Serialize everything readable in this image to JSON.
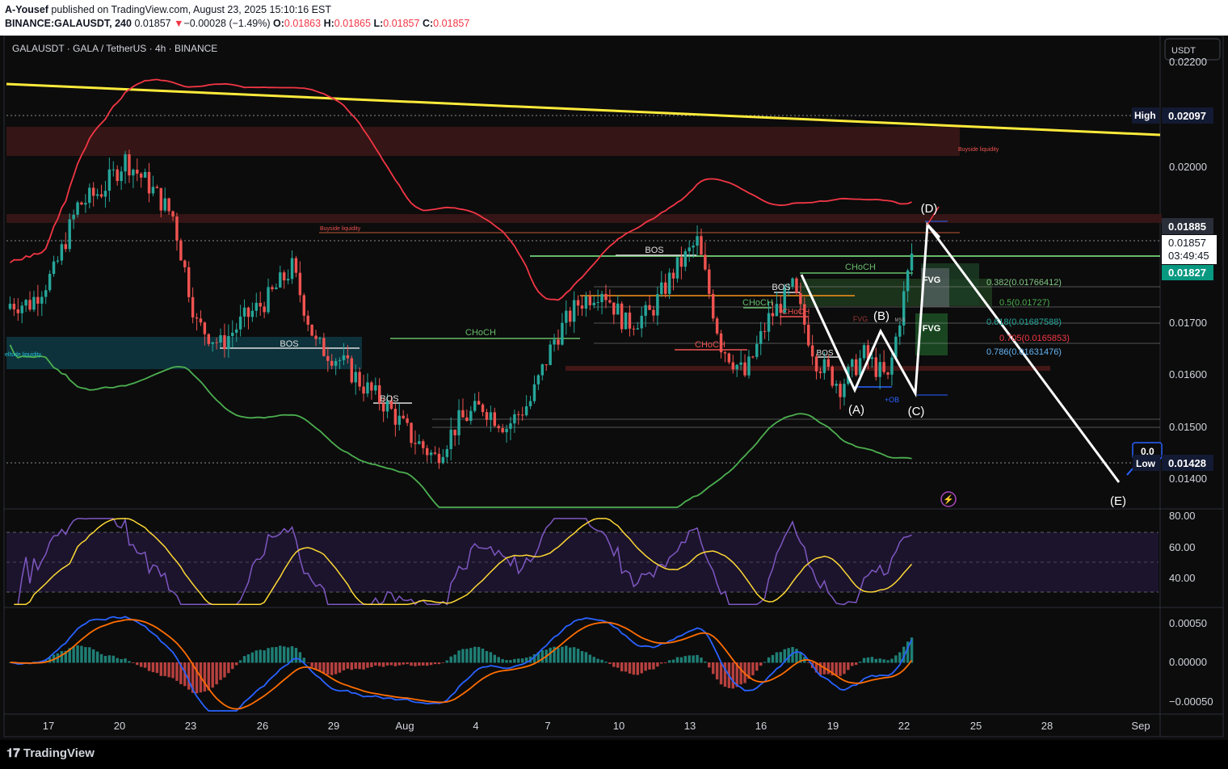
{
  "header": {
    "publisher": "A-Yousef",
    "published_text": "published on TradingView.com, August 23, 2025 15:10:16 EST",
    "symbol_line": "BINANCE:GALAUSDT, 240",
    "last": "0.01857",
    "change_symbol": "▼",
    "change": "−0.00028 (−1.49%)",
    "o_label": "O:",
    "o_val": "0.01863",
    "h_label": "H:",
    "h_val": "0.01865",
    "l_label": "L:",
    "l_val": "0.01857",
    "c_label": "C:",
    "c_val": "0.01857"
  },
  "legend": "GALAUSDT · GALA / TetherUS · 4h · BINANCE",
  "currency_button": "USDT",
  "price_axis": [
    "0.02200",
    "0.02000",
    "0.01885",
    "0.01700",
    "0.01600",
    "0.01500",
    "0.01400"
  ],
  "price_labels": {
    "high_label": "High",
    "high_value": "0.02097",
    "current": "0.01857",
    "countdown": "03:49:45",
    "green_line": "0.01827",
    "low_label": "Low",
    "low_value": "0.01428",
    "alert_partial": "0.0"
  },
  "rsi_axis": [
    "80.00",
    "60.00",
    "40.00"
  ],
  "macd_axis": [
    "0.00050",
    "0.00000",
    "−0.00050"
  ],
  "time_axis": [
    "17",
    "20",
    "23",
    "26",
    "29",
    "Aug",
    "4",
    "7",
    "10",
    "13",
    "16",
    "19",
    "22",
    "25",
    "28",
    "Sep"
  ],
  "annotations": {
    "bos": "BOS",
    "choch": "CHoCH",
    "fvg": "FVG",
    "fvg_faint": "FVG",
    "mss": "MSS",
    "plus_ob": "+OB",
    "buyside_liquidity": "Buyside liquidity",
    "sellside_liquidity": "ellside liquidity",
    "wave_a": "(A)",
    "wave_b": "(B)",
    "wave_c": "(C)",
    "wave_d": "(D)",
    "wave_e": "(E)"
  },
  "fib_levels": [
    {
      "text": "0.382(0.01766412)",
      "color": "#81c784"
    },
    {
      "text": "0.5(0.01727)",
      "color": "#4caf50"
    },
    {
      "text": "0.618(0.01687588)",
      "color": "#089981"
    },
    {
      "text": "0.705(0.0165853)",
      "color": "#f23645"
    },
    {
      "text": "0.786(0.01631476)",
      "color": "#64b5f6"
    }
  ],
  "brand": "TradingView",
  "colors": {
    "up": "#26a69a",
    "down": "#ef5350",
    "bb_upper": "#f23645",
    "bb_lower": "#4caf50",
    "trendline": "#ffeb3b",
    "rsi": "#7e57c2",
    "rsi_ma": "#fdd835",
    "macd": "#2962ff",
    "signal": "#ff6d00"
  },
  "chart_data": {
    "type": "candlestick",
    "symbol": "GALAUSDT",
    "timeframe": "4h",
    "x": [
      "Jul 17",
      "Jul 18",
      "Jul 19",
      "Jul 20",
      "Jul 21",
      "Jul 22",
      "Jul 23",
      "Jul 24",
      "Jul 25",
      "Jul 26",
      "Jul 27",
      "Jul 28",
      "Jul 29",
      "Jul 30",
      "Jul 31",
      "Aug 1",
      "Aug 2",
      "Aug 3",
      "Aug 4",
      "Aug 5",
      "Aug 6",
      "Aug 7",
      "Aug 8",
      "Aug 9",
      "Aug 10",
      "Aug 11",
      "Aug 12",
      "Aug 13",
      "Aug 14",
      "Aug 15",
      "Aug 16",
      "Aug 17",
      "Aug 18",
      "Aug 19",
      "Aug 20",
      "Aug 21",
      "Aug 22",
      "Aug 23"
    ],
    "close_approx": [
      0.0176,
      0.0182,
      0.0195,
      0.0198,
      0.0204,
      0.0199,
      0.0193,
      0.0172,
      0.0168,
      0.0173,
      0.0177,
      0.0183,
      0.0168,
      0.0165,
      0.016,
      0.0156,
      0.015,
      0.0146,
      0.0153,
      0.0156,
      0.0152,
      0.0157,
      0.0169,
      0.0176,
      0.0179,
      0.0172,
      0.0174,
      0.0182,
      0.0188,
      0.0168,
      0.0162,
      0.0173,
      0.0179,
      0.0165,
      0.016,
      0.0166,
      0.0161,
      0.01857
    ],
    "ylim": [
      0.0136,
      0.0223
    ],
    "high": 0.02097,
    "low": 0.01428,
    "last": 0.01857,
    "levels": {
      "resistance_green": 0.01827,
      "level_0_01885": 0.01885
    },
    "fibonacci": [
      {
        "ratio": 0.382,
        "price": 0.01766412
      },
      {
        "ratio": 0.5,
        "price": 0.01727
      },
      {
        "ratio": 0.618,
        "price": 0.01687588
      },
      {
        "ratio": 0.705,
        "price": 0.0165853
      },
      {
        "ratio": 0.786,
        "price": 0.01631476
      }
    ],
    "elliott_waves": [
      "(A)",
      "(B)",
      "(C)",
      "(D)",
      "(E)"
    ],
    "rsi": {
      "ylim": [
        25,
        85
      ],
      "band": [
        30,
        70
      ],
      "ticks": [
        80,
        60,
        40
      ]
    },
    "macd": {
      "ylim": [
        -0.0006,
        0.0007
      ],
      "ticks": [
        0.0005,
        0,
        -0.0005
      ]
    }
  }
}
